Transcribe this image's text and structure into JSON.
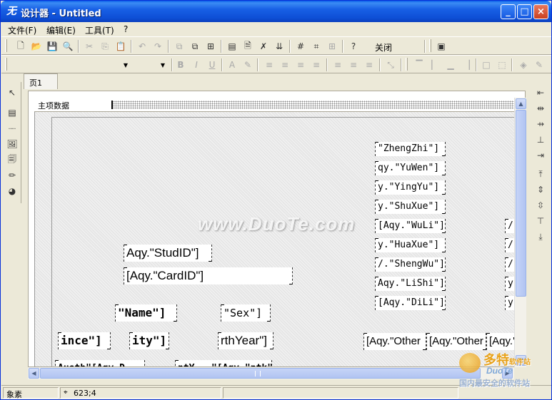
{
  "window": {
    "title": "设计器 - Untitled",
    "controls": [
      "_",
      "□",
      "×"
    ]
  },
  "menu": [
    {
      "label": "文件(F)"
    },
    {
      "label": "编辑(E)"
    },
    {
      "label": "工具(T)"
    },
    {
      "label": "?"
    }
  ],
  "toolbar1": {
    "close_label": "关闭"
  },
  "tabs": [
    {
      "label": "页1"
    }
  ],
  "band": {
    "header_label": "主项数据"
  },
  "fields": {
    "zhengzhi": "\"ZhengZhi\"]",
    "yuwen": "qy.\"YuWen\"]",
    "yingyu": "y.\"YingYu\"]",
    "shuxue": "y.\"ShuXue\"]",
    "wuli": "[Aqy.\"WuLi\"]",
    "huaxue": "y.\"HuaXue\"]",
    "shengwu": "/.\"ShengWu\"]",
    "lishi": "Aqy.\"LiShi\"]",
    "dili": "[Aqy.\"DiLi\"]",
    "studid": "Aqy.\"StudID\"]",
    "cardid": "[Aqy.\"CardID\"]",
    "name": "\"Name\"]",
    "sex": "\"Sex\"]",
    "province": "ince\"]",
    "city": "ity\"]",
    "birthyear": "rthYear\"]",
    "other1": "[Aqy.\"Other",
    "other2": "[Aqy.\"Other",
    "other3": "[Aqy.'",
    "edge1": "/.",
    "edge2": "/.",
    "edge3": "/.",
    "edge4": "y",
    "edge5": "y",
    "bottom1": "Austh\"[Aqy.D.",
    "bottom2": "ntY...\"[Aqy.\"ntk\""
  },
  "watermark": "www.DuoTe.com",
  "corner_logo": {
    "line1": "多特",
    "line2": "DuoTe",
    "line3": "国内最安全的软件站",
    "tagline": "软件站"
  },
  "status": {
    "left": "象素",
    "coords": "623;4"
  }
}
